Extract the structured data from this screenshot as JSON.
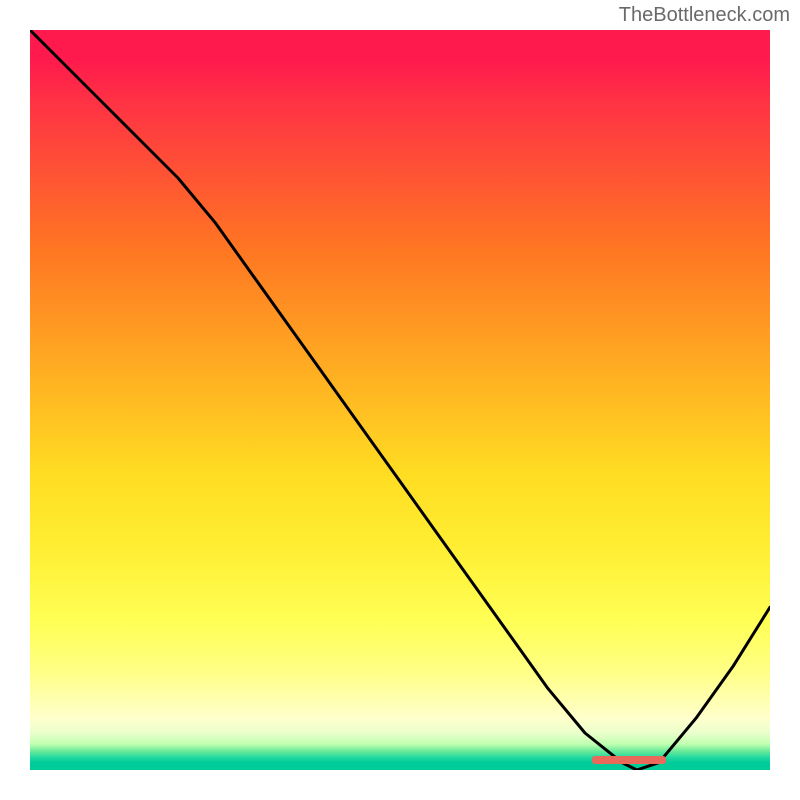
{
  "watermark": "TheBottleneck.com",
  "chart_data": {
    "type": "line",
    "title": "",
    "xlabel": "",
    "ylabel": "",
    "xlim": [
      0,
      100
    ],
    "ylim": [
      0,
      100
    ],
    "x": [
      0,
      5,
      10,
      15,
      20,
      25,
      30,
      35,
      40,
      45,
      50,
      55,
      60,
      65,
      70,
      75,
      80,
      82,
      85,
      90,
      95,
      100
    ],
    "values": [
      100,
      95,
      90,
      85,
      80,
      74,
      67,
      60,
      53,
      46,
      39,
      32,
      25,
      18,
      11,
      5,
      1,
      0,
      1,
      7,
      14,
      22
    ],
    "gradient_stops": [
      {
        "pos": 0,
        "color": "#ff1a4d",
        "meaning": "high-bottleneck"
      },
      {
        "pos": 50,
        "color": "#ffdd22",
        "meaning": "moderate"
      },
      {
        "pos": 99,
        "color": "#00cc99",
        "meaning": "optimal"
      }
    ],
    "optimal_zone": {
      "x_start": 76,
      "x_end": 86,
      "color": "#e96a5a"
    },
    "annotations": []
  }
}
